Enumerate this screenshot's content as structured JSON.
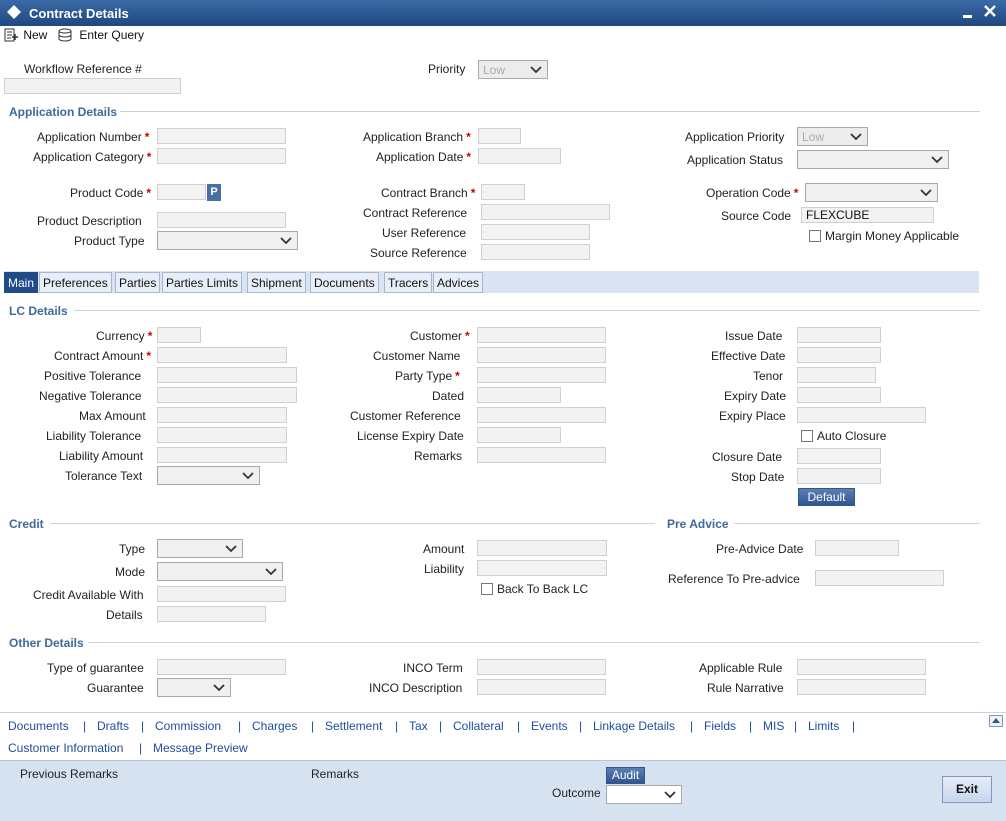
{
  "window": {
    "title": "Contract Details"
  },
  "toolbar": {
    "new_label": "New",
    "enter_query_label": "Enter Query"
  },
  "top": {
    "workflow_ref_label": "Workflow Reference #",
    "priority_label": "Priority",
    "priority_value": "Low"
  },
  "application": {
    "title": "Application Details",
    "app_number_label": "Application Number",
    "app_category_label": "Application Category",
    "product_code_label": "Product Code",
    "product_code_btn": "P",
    "product_desc_label": "Product Description",
    "product_type_label": "Product Type",
    "app_branch_label": "Application Branch",
    "app_date_label": "Application Date",
    "contract_branch_label": "Contract Branch",
    "contract_ref_label": "Contract Reference",
    "user_ref_label": "User Reference",
    "source_ref_label": "Source Reference",
    "app_priority_label": "Application Priority",
    "app_priority_value": "Low",
    "app_status_label": "Application Status",
    "operation_code_label": "Operation Code",
    "source_code_label": "Source Code",
    "source_code_value": "FLEXCUBE",
    "margin_money_label": "Margin Money Applicable"
  },
  "tabs": [
    "Main",
    "Preferences",
    "Parties",
    "Parties Limits",
    "Shipment",
    "Documents",
    "Tracers",
    "Advices"
  ],
  "lc": {
    "title": "LC Details",
    "currency_label": "Currency",
    "contract_amount_label": "Contract Amount",
    "positive_tol_label": "Positive Tolerance",
    "negative_tol_label": "Negative Tolerance",
    "max_amount_label": "Max Amount",
    "liability_tol_label": "Liability Tolerance",
    "liability_amount_label": "Liability Amount",
    "tolerance_text_label": "Tolerance Text",
    "customer_label": "Customer",
    "customer_name_label": "Customer Name",
    "party_type_label": "Party Type",
    "dated_label": "Dated",
    "customer_ref_label": "Customer Reference",
    "license_expiry_label": "License Expiry Date",
    "remarks_label": "Remarks",
    "issue_date_label": "Issue Date",
    "effective_date_label": "Effective Date",
    "tenor_label": "Tenor",
    "expiry_date_label": "Expiry Date",
    "expiry_place_label": "Expiry Place",
    "auto_closure_label": "Auto Closure",
    "closure_date_label": "Closure Date",
    "stop_date_label": "Stop Date",
    "default_btn": "Default"
  },
  "credit": {
    "title": "Credit",
    "type_label": "Type",
    "mode_label": "Mode",
    "available_with_label": "Credit Available With",
    "details_label": "Details",
    "amount_label": "Amount",
    "liability_label": "Liability",
    "back_to_back_label": "Back To Back LC"
  },
  "pre_advice": {
    "title": "Pre Advice",
    "date_label": "Pre-Advice Date",
    "ref_label": "Reference To Pre-advice"
  },
  "other": {
    "title": "Other Details",
    "type_guarantee_label": "Type of guarantee",
    "guarantee_label": "Guarantee",
    "inco_term_label": "INCO Term",
    "inco_desc_label": "INCO Description",
    "applicable_rule_label": "Applicable Rule",
    "rule_narrative_label": "Rule Narrative"
  },
  "links": [
    "Documents",
    "Drafts",
    "Commission",
    "Charges",
    "Settlement",
    "Tax",
    "Collateral",
    "Events",
    "Linkage Details",
    "Fields",
    "MIS",
    "Limits",
    "Customer Information",
    "Message Preview"
  ],
  "footer": {
    "previous_remarks_label": "Previous Remarks",
    "remarks_label": "Remarks",
    "audit_btn": "Audit",
    "outcome_label": "Outcome",
    "exit_btn": "Exit"
  },
  "colors": {
    "title_bar": "#1f4880",
    "section_title": "#3e6a9a",
    "link": "#1e4c9c",
    "required": "#cc0000",
    "footer": "#d7e2f1"
  }
}
